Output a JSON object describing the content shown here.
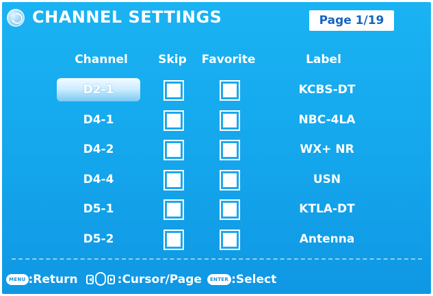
{
  "header": {
    "title": "CHANNEL SETTINGS",
    "page": "Page 1/19",
    "logo_icon": "globe-icon"
  },
  "columns": {
    "channel": "Channel",
    "skip": "Skip",
    "favorite": "Favorite",
    "label": "Label"
  },
  "rows": [
    {
      "channel": "D2-1",
      "label": "KCBS-DT",
      "skip": false,
      "favorite": false,
      "selected": true
    },
    {
      "channel": "D4-1",
      "label": "NBC-4LA",
      "skip": false,
      "favorite": false,
      "selected": false
    },
    {
      "channel": "D4-2",
      "label": "WX+ NR",
      "skip": false,
      "favorite": false,
      "selected": false
    },
    {
      "channel": "D4-4",
      "label": "USN",
      "skip": false,
      "favorite": false,
      "selected": false
    },
    {
      "channel": "D5-1",
      "label": "KTLA-DT",
      "skip": false,
      "favorite": false,
      "selected": false
    },
    {
      "channel": "D5-2",
      "label": "Antenna",
      "skip": false,
      "favorite": false,
      "selected": false
    }
  ],
  "footer": {
    "menu_key": "MENU",
    "return_label": ":Return",
    "cursor_label": ":Cursor/Page",
    "enter_key": "ENTER",
    "select_label": ":Select",
    "dpad_icon": "dpad-icon"
  },
  "colors": {
    "background": "#14a6ec",
    "text": "#ffffff",
    "page_badge_text": "#1565c0"
  }
}
